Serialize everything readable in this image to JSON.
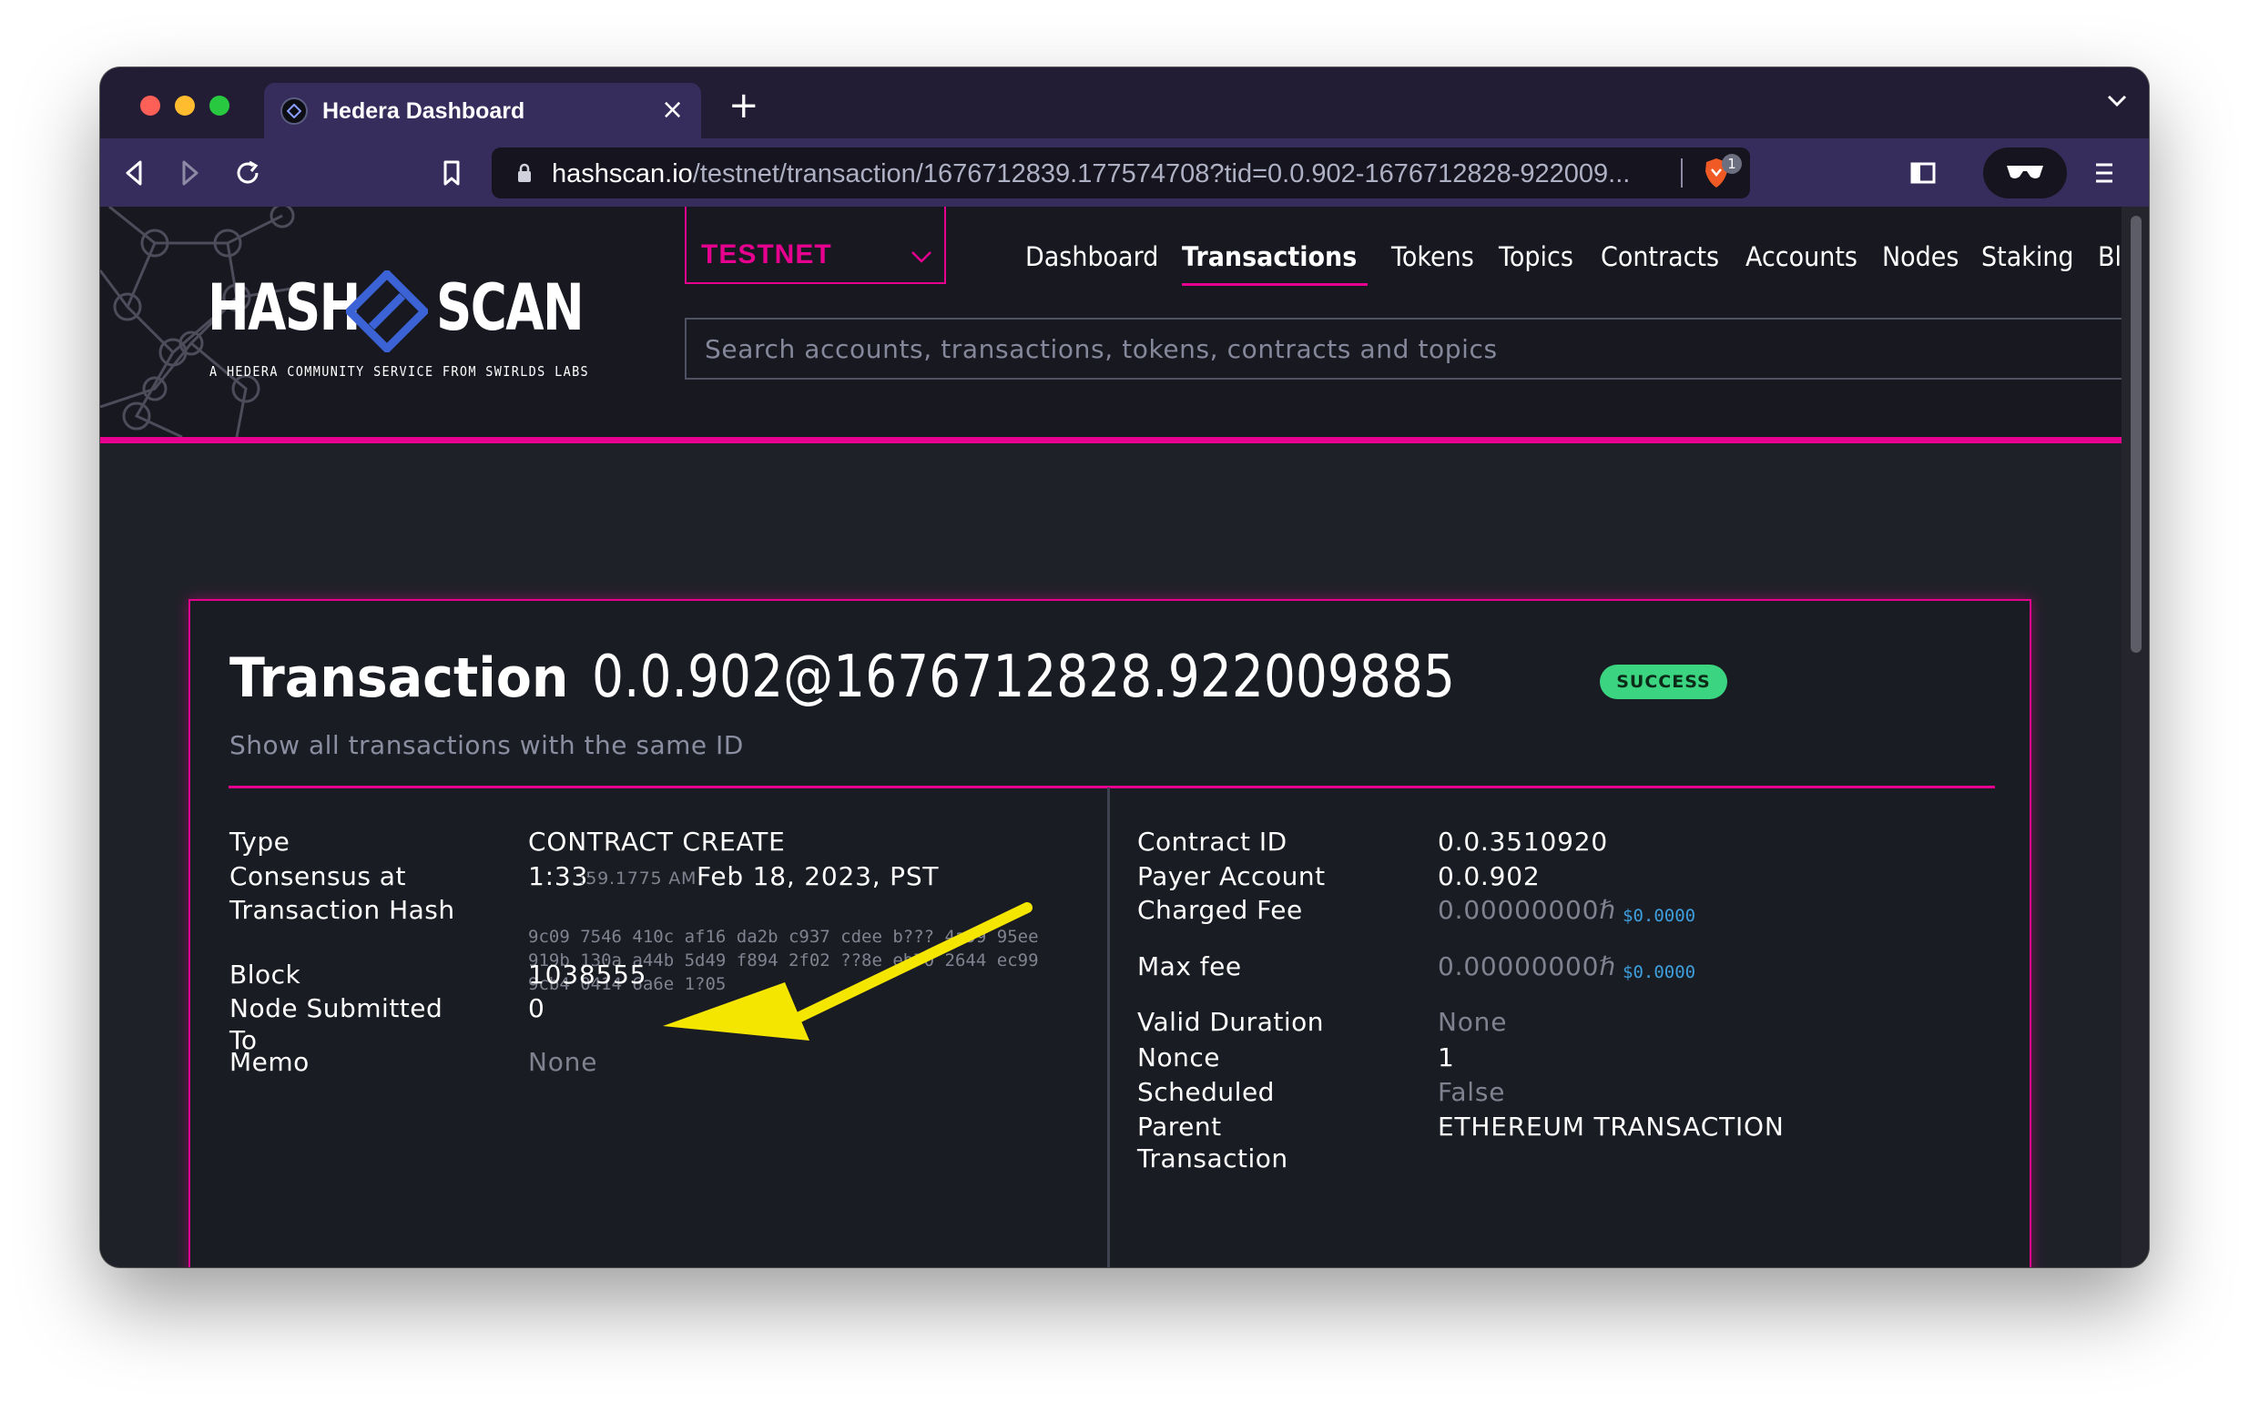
{
  "browser": {
    "tab_title": "Hedera Dashboard",
    "tab_close": "×",
    "new_tab": "+",
    "url_host": "hashscan.io",
    "url_path": "/testnet/transaction/1676712839.177574708?tid=0.0.902-1676712828-922009...",
    "shields_count": "1"
  },
  "header": {
    "logo_left": "HASH",
    "logo_right": "SCAN",
    "tagline": "A HEDERA COMMUNITY SERVICE FROM SWIRLDS LABS",
    "network": "TESTNET",
    "nav": [
      "Dashboard",
      "Transactions",
      "Tokens",
      "Topics",
      "Contracts",
      "Accounts",
      "Nodes",
      "Staking",
      "Bl"
    ],
    "active_nav": "Transactions",
    "search_placeholder": "Search accounts, transactions, tokens, contracts and topics"
  },
  "transaction": {
    "title_label": "Transaction",
    "title_id": "0.0.902@1676712828.922009885",
    "status": "SUCCESS",
    "same_id_link": "Show all transactions with the same ID",
    "left": {
      "type_label": "Type",
      "type_value": "CONTRACT CREATE",
      "consensus_label": "Consensus at",
      "consensus_time": "1:33",
      "consensus_seconds": ":59.1775 AM",
      "consensus_date": "Feb 18, 2023, PST",
      "hash_label": "Transaction Hash",
      "hash_lines": [
        "9c09 7546 410c af16 da2b c937 cdee b??? 4a99 95ee",
        "919b 130a a44b 5d49 f894 2f02 ??8e eb70 2644 ec99",
        "9cb4 0414 6a6e 1?05"
      ],
      "block_label": "Block",
      "block_value": "1038555",
      "node_label": "Node Submitted To",
      "node_value": "0",
      "memo_label": "Memo",
      "memo_value": "None"
    },
    "right": {
      "contract_label": "Contract ID",
      "contract_value": "0.0.3510920",
      "payer_label": "Payer Account",
      "payer_value": "0.0.902",
      "charged_label": "Charged Fee",
      "charged_value": "0.00000000ℏ",
      "charged_usd": "$0.0000",
      "maxfee_label": "Max fee",
      "maxfee_value": "0.00000000ℏ",
      "maxfee_usd": "$0.0000",
      "duration_label": "Valid Duration",
      "duration_value": "None",
      "nonce_label": "Nonce",
      "nonce_value": "1",
      "scheduled_label": "Scheduled",
      "scheduled_value": "False",
      "parent_label": "Parent Transaction",
      "parent_value": "ETHEREUM TRANSACTION"
    }
  },
  "annotation": {
    "arrow_color": "#f5e600"
  },
  "colors": {
    "accent": "#e6018f",
    "success": "#3bd481",
    "link": "#3e9fdd"
  }
}
